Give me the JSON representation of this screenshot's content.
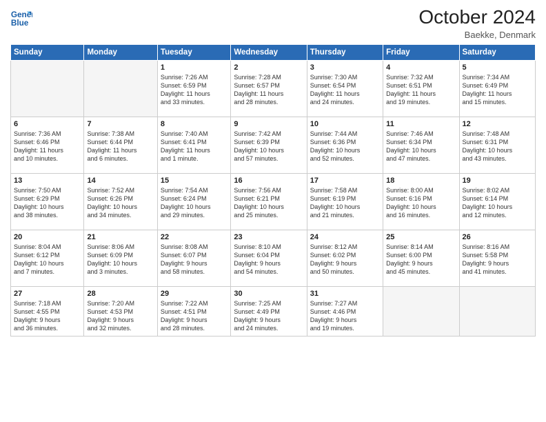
{
  "header": {
    "logo_line1": "General",
    "logo_line2": "Blue",
    "month": "October 2024",
    "location": "Baekke, Denmark"
  },
  "days_of_week": [
    "Sunday",
    "Monday",
    "Tuesday",
    "Wednesday",
    "Thursday",
    "Friday",
    "Saturday"
  ],
  "weeks": [
    [
      {
        "num": "",
        "detail": ""
      },
      {
        "num": "",
        "detail": ""
      },
      {
        "num": "1",
        "detail": "Sunrise: 7:26 AM\nSunset: 6:59 PM\nDaylight: 11 hours\nand 33 minutes."
      },
      {
        "num": "2",
        "detail": "Sunrise: 7:28 AM\nSunset: 6:57 PM\nDaylight: 11 hours\nand 28 minutes."
      },
      {
        "num": "3",
        "detail": "Sunrise: 7:30 AM\nSunset: 6:54 PM\nDaylight: 11 hours\nand 24 minutes."
      },
      {
        "num": "4",
        "detail": "Sunrise: 7:32 AM\nSunset: 6:51 PM\nDaylight: 11 hours\nand 19 minutes."
      },
      {
        "num": "5",
        "detail": "Sunrise: 7:34 AM\nSunset: 6:49 PM\nDaylight: 11 hours\nand 15 minutes."
      }
    ],
    [
      {
        "num": "6",
        "detail": "Sunrise: 7:36 AM\nSunset: 6:46 PM\nDaylight: 11 hours\nand 10 minutes."
      },
      {
        "num": "7",
        "detail": "Sunrise: 7:38 AM\nSunset: 6:44 PM\nDaylight: 11 hours\nand 6 minutes."
      },
      {
        "num": "8",
        "detail": "Sunrise: 7:40 AM\nSunset: 6:41 PM\nDaylight: 11 hours\nand 1 minute."
      },
      {
        "num": "9",
        "detail": "Sunrise: 7:42 AM\nSunset: 6:39 PM\nDaylight: 10 hours\nand 57 minutes."
      },
      {
        "num": "10",
        "detail": "Sunrise: 7:44 AM\nSunset: 6:36 PM\nDaylight: 10 hours\nand 52 minutes."
      },
      {
        "num": "11",
        "detail": "Sunrise: 7:46 AM\nSunset: 6:34 PM\nDaylight: 10 hours\nand 47 minutes."
      },
      {
        "num": "12",
        "detail": "Sunrise: 7:48 AM\nSunset: 6:31 PM\nDaylight: 10 hours\nand 43 minutes."
      }
    ],
    [
      {
        "num": "13",
        "detail": "Sunrise: 7:50 AM\nSunset: 6:29 PM\nDaylight: 10 hours\nand 38 minutes."
      },
      {
        "num": "14",
        "detail": "Sunrise: 7:52 AM\nSunset: 6:26 PM\nDaylight: 10 hours\nand 34 minutes."
      },
      {
        "num": "15",
        "detail": "Sunrise: 7:54 AM\nSunset: 6:24 PM\nDaylight: 10 hours\nand 29 minutes."
      },
      {
        "num": "16",
        "detail": "Sunrise: 7:56 AM\nSunset: 6:21 PM\nDaylight: 10 hours\nand 25 minutes."
      },
      {
        "num": "17",
        "detail": "Sunrise: 7:58 AM\nSunset: 6:19 PM\nDaylight: 10 hours\nand 21 minutes."
      },
      {
        "num": "18",
        "detail": "Sunrise: 8:00 AM\nSunset: 6:16 PM\nDaylight: 10 hours\nand 16 minutes."
      },
      {
        "num": "19",
        "detail": "Sunrise: 8:02 AM\nSunset: 6:14 PM\nDaylight: 10 hours\nand 12 minutes."
      }
    ],
    [
      {
        "num": "20",
        "detail": "Sunrise: 8:04 AM\nSunset: 6:12 PM\nDaylight: 10 hours\nand 7 minutes."
      },
      {
        "num": "21",
        "detail": "Sunrise: 8:06 AM\nSunset: 6:09 PM\nDaylight: 10 hours\nand 3 minutes."
      },
      {
        "num": "22",
        "detail": "Sunrise: 8:08 AM\nSunset: 6:07 PM\nDaylight: 9 hours\nand 58 minutes."
      },
      {
        "num": "23",
        "detail": "Sunrise: 8:10 AM\nSunset: 6:04 PM\nDaylight: 9 hours\nand 54 minutes."
      },
      {
        "num": "24",
        "detail": "Sunrise: 8:12 AM\nSunset: 6:02 PM\nDaylight: 9 hours\nand 50 minutes."
      },
      {
        "num": "25",
        "detail": "Sunrise: 8:14 AM\nSunset: 6:00 PM\nDaylight: 9 hours\nand 45 minutes."
      },
      {
        "num": "26",
        "detail": "Sunrise: 8:16 AM\nSunset: 5:58 PM\nDaylight: 9 hours\nand 41 minutes."
      }
    ],
    [
      {
        "num": "27",
        "detail": "Sunrise: 7:18 AM\nSunset: 4:55 PM\nDaylight: 9 hours\nand 36 minutes."
      },
      {
        "num": "28",
        "detail": "Sunrise: 7:20 AM\nSunset: 4:53 PM\nDaylight: 9 hours\nand 32 minutes."
      },
      {
        "num": "29",
        "detail": "Sunrise: 7:22 AM\nSunset: 4:51 PM\nDaylight: 9 hours\nand 28 minutes."
      },
      {
        "num": "30",
        "detail": "Sunrise: 7:25 AM\nSunset: 4:49 PM\nDaylight: 9 hours\nand 24 minutes."
      },
      {
        "num": "31",
        "detail": "Sunrise: 7:27 AM\nSunset: 4:46 PM\nDaylight: 9 hours\nand 19 minutes."
      },
      {
        "num": "",
        "detail": ""
      },
      {
        "num": "",
        "detail": ""
      }
    ]
  ]
}
